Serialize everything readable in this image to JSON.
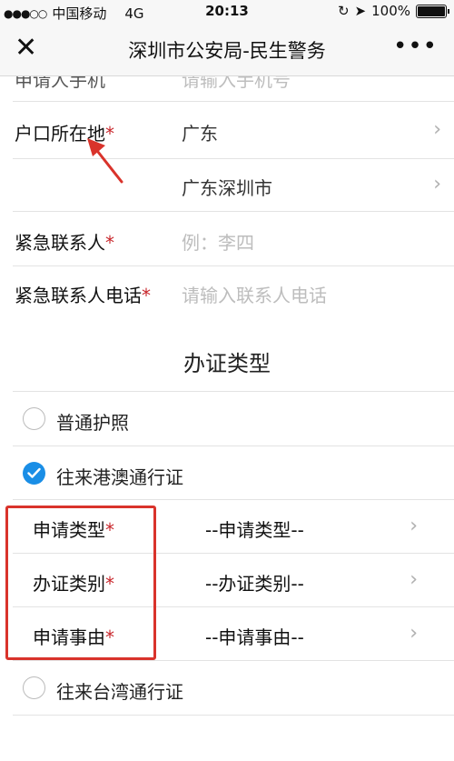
{
  "status_bar": {
    "signal": "●●●○○",
    "carrier": "中国移动",
    "network": "4G",
    "time": "20:13",
    "battery": "100%",
    "battery_level": 1.0
  },
  "nav": {
    "title": "深圳市公安局-民生警务",
    "close_icon": "close-icon",
    "more_icon": "more-icon"
  },
  "form": {
    "cut_row": {
      "label": "申请人手机",
      "placeholder": "请输入手机号"
    },
    "household": {
      "label": "户口所在地",
      "required": "*",
      "province": "广东",
      "city": "广东深圳市"
    },
    "emergency_contact": {
      "label": "紧急联系人",
      "required": "*",
      "placeholder": "例：李四"
    },
    "emergency_phone": {
      "label": "紧急联系人电话",
      "required": "*",
      "placeholder": "请输入联系人电话"
    }
  },
  "section": {
    "title": "办证类型"
  },
  "options": [
    {
      "label": "普通护照",
      "checked": false
    },
    {
      "label": "往来港澳通行证",
      "checked": true
    },
    {
      "label": "往来台湾通行证",
      "checked": false
    }
  ],
  "sub_fields": [
    {
      "label": "申请类型",
      "required": "*",
      "value": "--申请类型--"
    },
    {
      "label": "办证类别",
      "required": "*",
      "value": "--办证类别--"
    },
    {
      "label": "申请事由",
      "required": "*",
      "value": "--申请事由--"
    }
  ],
  "colors": {
    "accent": "#1a8ee6",
    "required": "#c8262b",
    "annotation": "#d9332b"
  }
}
